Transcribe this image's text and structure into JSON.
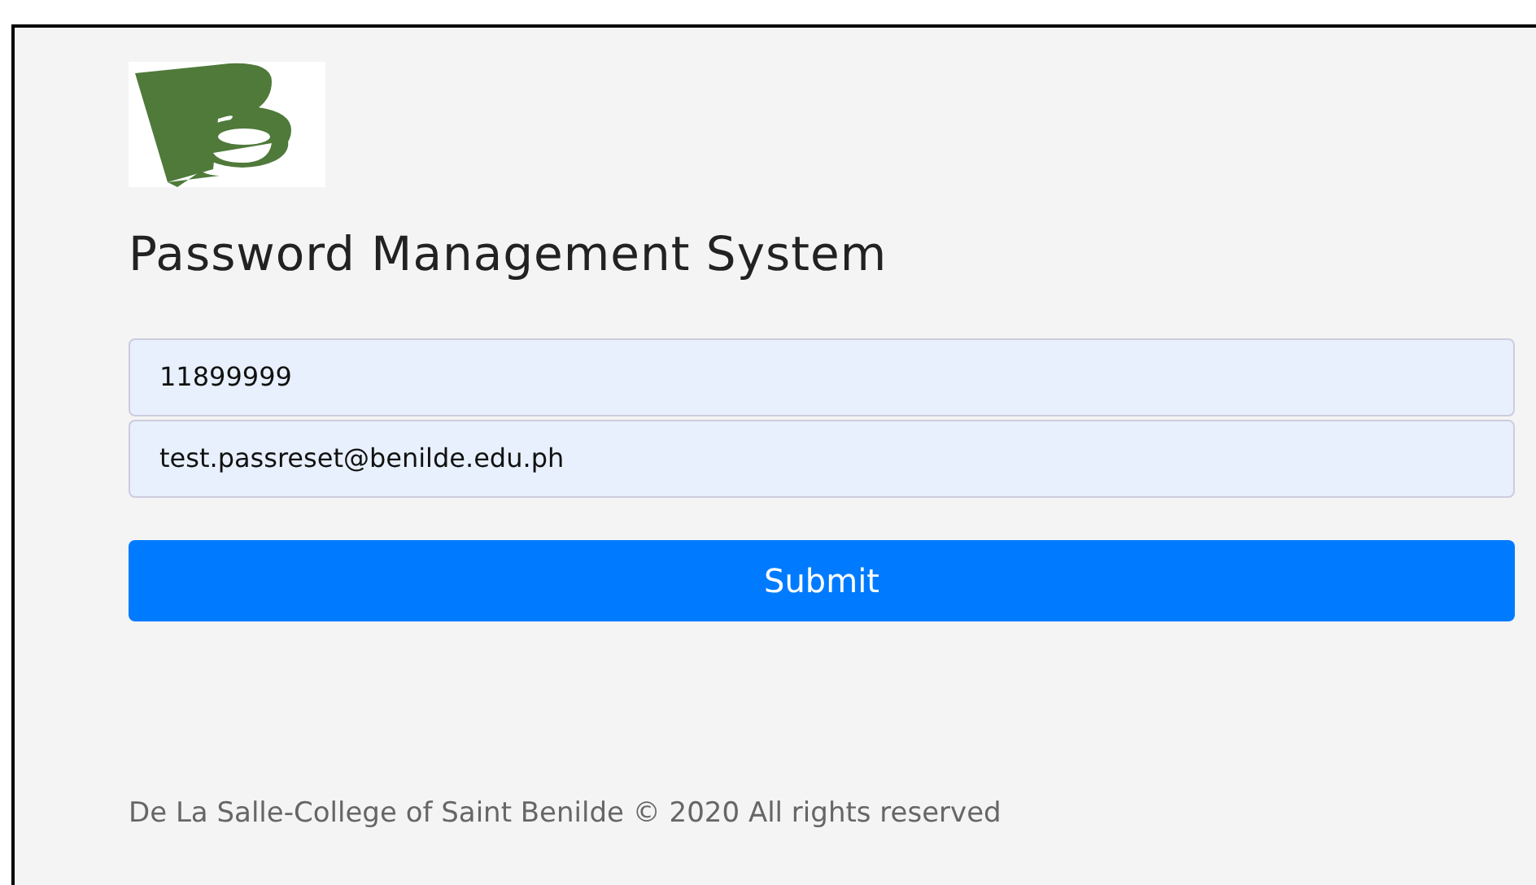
{
  "title": "Password Management System",
  "fields": [
    {
      "value": "11899999"
    },
    {
      "value": "test.passreset@benilde.edu.ph"
    }
  ],
  "submit": "Submit",
  "footer": "De La Salle-College of Saint Benilde © 2020 All rights reserved"
}
